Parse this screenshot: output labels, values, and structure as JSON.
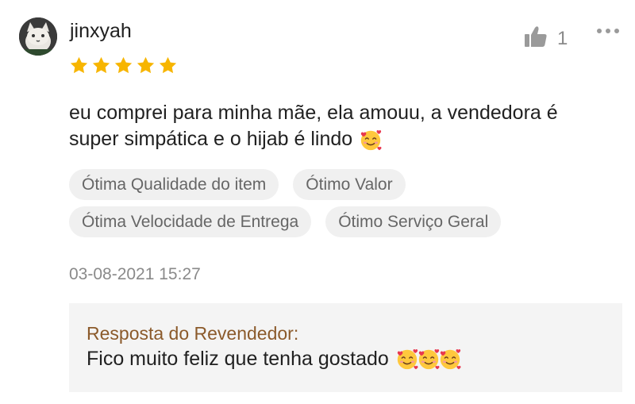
{
  "review": {
    "username": "jinxyah",
    "rating": 5,
    "like_count": "1",
    "text_line1": "eu comprei para minha mãe, ela amouu, a vendedora é",
    "text_line2": "super simpática e o hijab é lindo",
    "tags": [
      "Ótima Qualidade do item",
      "Ótimo Valor",
      "Ótima Velocidade de Entrega",
      "Ótimo Serviço Geral"
    ],
    "date": "03-08-2021 15:27"
  },
  "reply": {
    "title": "Resposta do Revendedor:",
    "text": "Fico muito feliz que tenha gostado"
  },
  "icons": {
    "like": "thumbs-up-icon",
    "more": "more-dots-icon",
    "star": "star-icon",
    "emoji": "smiling-face-with-hearts-emoji"
  },
  "colors": {
    "star": "#F7B500",
    "reply_title": "#8B5A2B",
    "tag_bg": "#F0F0F0",
    "reply_bg": "#F4F4F4"
  }
}
